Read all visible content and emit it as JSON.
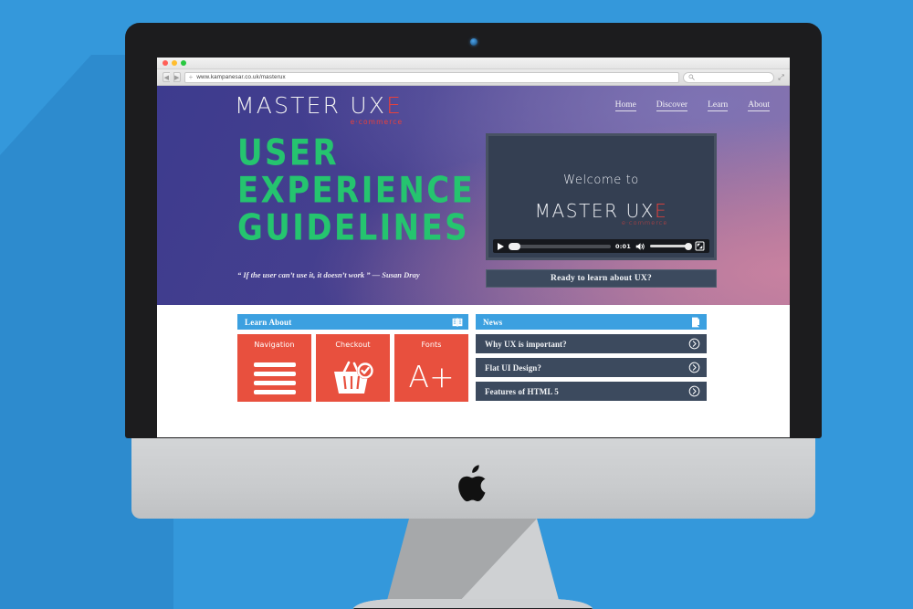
{
  "browser": {
    "url": "www.kampanesar.co.uk/masterux",
    "search_placeholder": "",
    "traffic_lights": [
      "close",
      "minimize",
      "zoom"
    ],
    "back_glyph": "◀",
    "forward_glyph": "▶",
    "plus_glyph": "+",
    "icons": {
      "search": "search-icon",
      "fullscreen": "fullscreen-icon"
    }
  },
  "site": {
    "logo": {
      "text_main": "MASTER UX",
      "text_accent": "E",
      "subtitle": "e·commerce",
      "accent_color": "#e8413c"
    },
    "nav": [
      {
        "label": "Home"
      },
      {
        "label": "Discover"
      },
      {
        "label": "Learn"
      },
      {
        "label": "About"
      }
    ],
    "hero": {
      "headline_lines": [
        "USER",
        "EXPERIENCE",
        "GUIDELINES"
      ],
      "headline_color": "#25c46f",
      "quote": "“ If the user can’t use it, it doesn’t work ”  — Susan Dray"
    },
    "video": {
      "welcome_text": "Welcome to",
      "logo_main": "MASTER UX",
      "logo_accent": "E",
      "logo_sub": "e·commerce",
      "time": "0:01",
      "play_icon": "play-icon",
      "volume_icon": "volume-icon",
      "fullscreen_icon": "video-fullscreen-icon"
    },
    "cta": {
      "label": "Ready to learn about UX?"
    },
    "learn_panel": {
      "title": "Learn About",
      "icon": "open-book-icon",
      "header_color": "#3ca0e0",
      "tile_color": "#e8503e",
      "tiles": [
        {
          "label": "Navigation",
          "icon": "hamburger-menu-icon"
        },
        {
          "label": "Checkout",
          "icon": "shopping-basket-check-icon"
        },
        {
          "label": "Fonts",
          "icon": "font-size-icon",
          "glyph": "A+"
        }
      ]
    },
    "news_panel": {
      "title": "News",
      "icon": "document-page-icon",
      "header_color": "#3ca0e0",
      "item_color": "#3c4a5e",
      "items": [
        {
          "label": "Why UX is important?",
          "icon": "chevron-right-circle-icon"
        },
        {
          "label": "Flat UI Design?",
          "icon": "chevron-right-circle-icon"
        },
        {
          "label": "Features of HTML 5",
          "icon": "chevron-right-circle-icon"
        }
      ]
    }
  },
  "device": {
    "brand_logo": "apple-logo",
    "camera": "webcam-icon",
    "background_color": "#3498db"
  }
}
